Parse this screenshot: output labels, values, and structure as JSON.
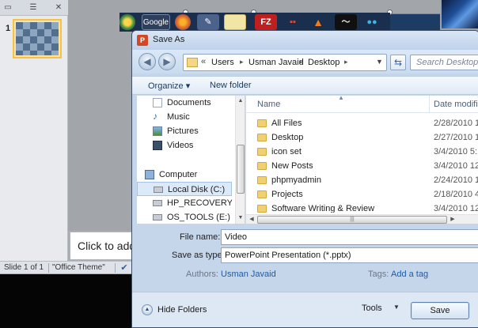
{
  "powerpoint": {
    "slide_number": "1",
    "notes_placeholder": "Click to add",
    "status_slide": "Slide 1 of 1",
    "status_theme": "\"Office Theme\""
  },
  "launcher": {
    "items": [
      "chrome-icon",
      "google-icon",
      "firefox-icon",
      "pen-icon",
      "notepad-icon",
      "filezilla-icon",
      "apps-icon",
      "vlc-icon",
      "wave-icon",
      "messenger-icon"
    ],
    "google_label": "Google",
    "filezilla_label": "FZ"
  },
  "dialog": {
    "title": "Save As",
    "app_icon_letter": "P",
    "address": {
      "overflow": "«",
      "crumbs": [
        "Users",
        "Usman Javaid",
        "Desktop"
      ],
      "separator": "▸"
    },
    "search_placeholder": "Search Desktop",
    "toolbar": {
      "organize_label": "Organize",
      "organize_arrow": "▾",
      "new_folder_label": "New folder"
    },
    "nav_items": [
      {
        "label": "Documents",
        "icon": "documents-icon"
      },
      {
        "label": "Music",
        "icon": "music-icon"
      },
      {
        "label": "Pictures",
        "icon": "pictures-icon"
      },
      {
        "label": "Videos",
        "icon": "videos-icon"
      },
      {
        "label": "Computer",
        "icon": "computer-icon"
      },
      {
        "label": "Local Disk (C:)",
        "icon": "drive-icon"
      },
      {
        "label": "HP_RECOVERY (D",
        "icon": "drive-icon"
      },
      {
        "label": "OS_TOOLS (E:)",
        "icon": "drive-icon"
      }
    ],
    "columns": {
      "name": "Name",
      "date": "Date modifi"
    },
    "files": [
      {
        "name": "All Files",
        "date": "2/28/2010 1"
      },
      {
        "name": "Desktop",
        "date": "2/27/2010 1"
      },
      {
        "name": "icon set",
        "date": "3/4/2010 5:1"
      },
      {
        "name": "New Posts",
        "date": "3/4/2010 12"
      },
      {
        "name": "phpmyadmin",
        "date": "2/24/2010 1"
      },
      {
        "name": "Projects",
        "date": "2/18/2010 4"
      },
      {
        "name": "Software Writing & Review",
        "date": "3/4/2010 12"
      }
    ],
    "form": {
      "file_name_label": "File name:",
      "file_name_value": "Video",
      "save_type_label": "Save as type:",
      "save_type_value": "PowerPoint Presentation (*.pptx)",
      "authors_label": "Authors:",
      "authors_value": "Usman Javaid",
      "tags_label": "Tags:",
      "tags_value": "Add a tag"
    },
    "footer": {
      "hide_folders_label": "Hide Folders",
      "tools_label": "Tools",
      "save_label": "Save"
    }
  },
  "colors": {
    "slide_bg": "#1d3c63",
    "thumb_highlight": "#f5c243",
    "dialog_frame": "#c5d6ea",
    "link_blue": "#1d5ba7"
  }
}
